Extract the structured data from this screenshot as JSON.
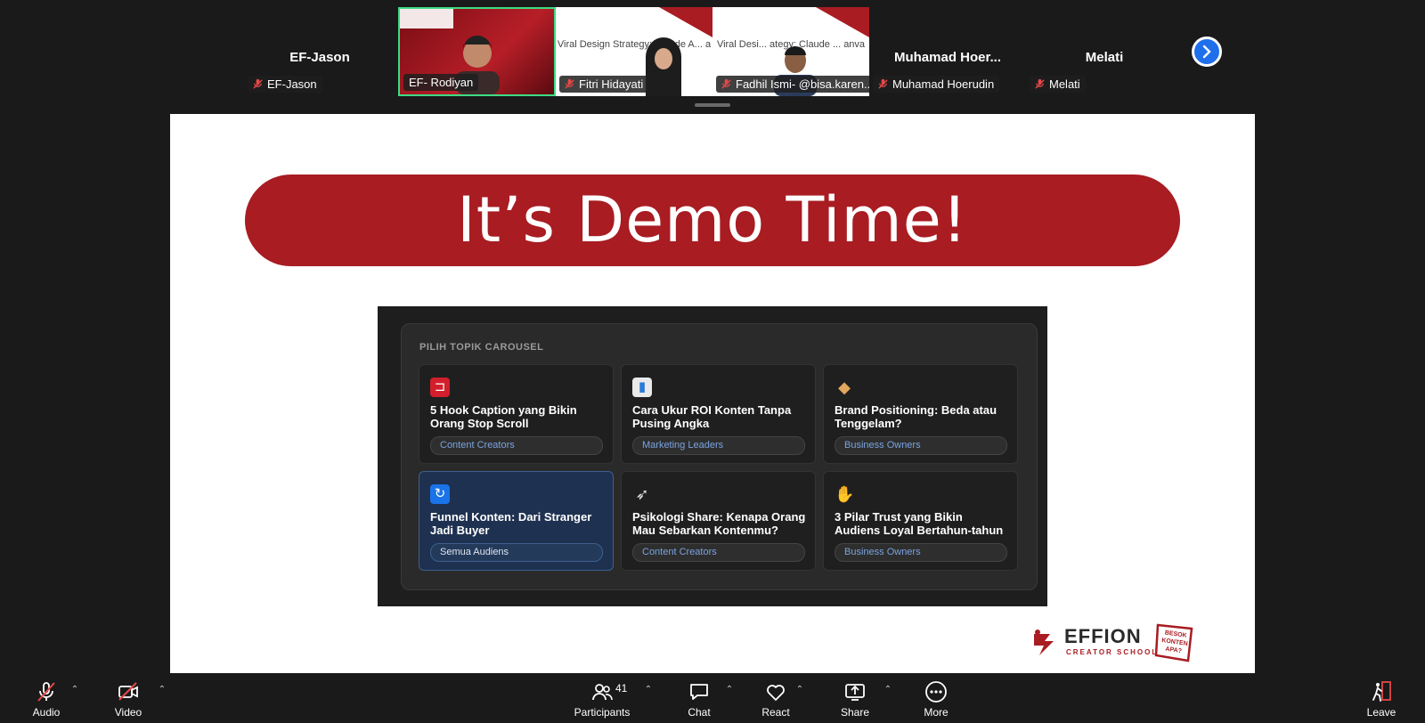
{
  "gallery": {
    "tiles": [
      {
        "big_name": "EF-Jason",
        "tag": "EF-Jason"
      },
      {
        "tag": "EF- Rodiyan"
      },
      {
        "thumb_title": "Viral Design Strategy: Claude A... a",
        "tag": "Fitri Hidayati"
      },
      {
        "thumb_title": "Viral Desi... ategy: Claude ... anva",
        "tag": "Fadhil Ismi- @bisa.karen..."
      },
      {
        "big_name": "Muhamad  Hoer...",
        "tag": "Muhamad Hoerudin"
      },
      {
        "big_name": "Melati",
        "tag": "Melati"
      }
    ]
  },
  "slide": {
    "heading": "It’s Demo Time!",
    "panel_title": "PILIH TOPIK CAROUSEL",
    "cards": [
      {
        "icon": "magnet-icon",
        "title": "5 Hook Caption yang Bikin Orang Stop Scroll",
        "tag": "Content Creators"
      },
      {
        "icon": "chart-icon",
        "title": "Cara Ukur ROI Konten Tanpa Pusing Angka",
        "tag": "Marketing Leaders"
      },
      {
        "icon": "tag-icon",
        "title": "Brand Positioning: Beda atau Tenggelam?",
        "tag": "Business Owners"
      },
      {
        "icon": "refresh-icon",
        "title": "Funnel Konten: Dari Stranger Jadi Buyer",
        "tag": "Semua Audiens"
      },
      {
        "icon": "rocket-icon",
        "title": "Psikologi Share: Kenapa Orang Mau Sebarkan Kontenmu?",
        "tag": "Content Creators"
      },
      {
        "icon": "handshake-icon",
        "title": "3 Pilar Trust yang Bikin Audiens Loyal Bertahun-tahun",
        "tag": "Business Owners"
      }
    ],
    "logo_text": "EFFION",
    "logo_sub": "CREATOR SCHOOL",
    "badge_text": "BESOK KONTEN APA?"
  },
  "toolbar": {
    "audio": "Audio",
    "video": "Video",
    "participants": "Participants",
    "participants_count": "41",
    "chat": "Chat",
    "react": "React",
    "share": "Share",
    "more": "More",
    "leave": "Leave"
  },
  "colors": {
    "brand_red": "#a81c22",
    "accent_blue": "#1f6feb",
    "active_border": "#3ddc84"
  }
}
